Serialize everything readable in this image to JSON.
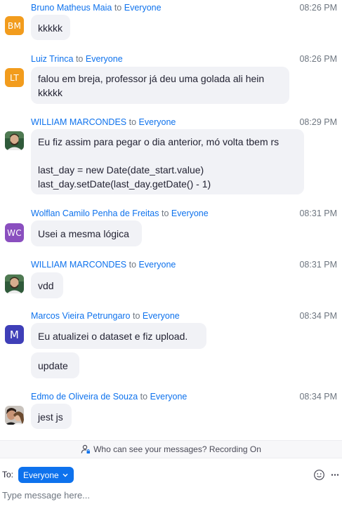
{
  "messages": [
    {
      "sender": "Bruno Matheus Maia",
      "to_word": "to",
      "recipient": "Everyone",
      "time": "08:26 PM",
      "avatar": {
        "initials": "BM",
        "color": "#f29c1d"
      },
      "bubbles": [
        "kkkkk"
      ]
    },
    {
      "sender": "Luiz Trinca",
      "to_word": "to",
      "recipient": "Everyone",
      "time": "08:26 PM",
      "avatar": {
        "initials": "LT",
        "color": "#f29c1d"
      },
      "bubbles": [
        "falou em breja, professor já deu uma golada ali hein\nkkkkk"
      ]
    },
    {
      "sender": "WILLIAM MARCONDES",
      "to_word": "to",
      "recipient": "Everyone",
      "time": "08:29 PM",
      "avatar": {
        "photo": "person-photo"
      },
      "bubbles": [
        "Eu fiz assim para pegar o dia anterior, mó volta tbem rs\n\nlast_day = new Date(date_start.value)\nlast_day.setDate(last_day.getDate() - 1)"
      ]
    },
    {
      "sender": "Wolflan Camilo Penha de Freitas",
      "to_word": "to",
      "recipient": "Everyone",
      "time": "08:31 PM",
      "avatar": {
        "initials": "WC",
        "color": "#8a4fbf"
      },
      "bubbles": [
        "Usei a mesma lógica"
      ]
    },
    {
      "sender": "WILLIAM MARCONDES",
      "to_word": "to",
      "recipient": "Everyone",
      "time": "08:31 PM",
      "avatar": {
        "photo": "person-photo"
      },
      "bubbles": [
        "vdd"
      ]
    },
    {
      "sender": "Marcos Vieira Petrungaro",
      "to_word": "to",
      "recipient": "Everyone",
      "time": "08:34 PM",
      "avatar": {
        "initials": "M",
        "color": "#3f3fb8"
      },
      "bubbles": [
        "Eu atualizei o dataset e fiz upload.",
        "update"
      ]
    },
    {
      "sender": "Edmo de Oliveira de Souza",
      "to_word": "to",
      "recipient": "Everyone",
      "time": "08:34 PM",
      "avatar": {
        "photo": "couple-photo"
      },
      "bubbles": [
        "jest js"
      ]
    }
  ],
  "privacy_notice": "Who can see your messages? Recording On",
  "composer": {
    "to_label": "To:",
    "recipient": "Everyone",
    "placeholder": "Type message here..."
  },
  "colors": {
    "accent": "#0e72ed",
    "bubble": "#f1f2f6",
    "muted": "#6e7680"
  },
  "icons": [
    "user-lock-icon",
    "chevron-down-icon",
    "emoji-icon",
    "more-icon"
  ]
}
